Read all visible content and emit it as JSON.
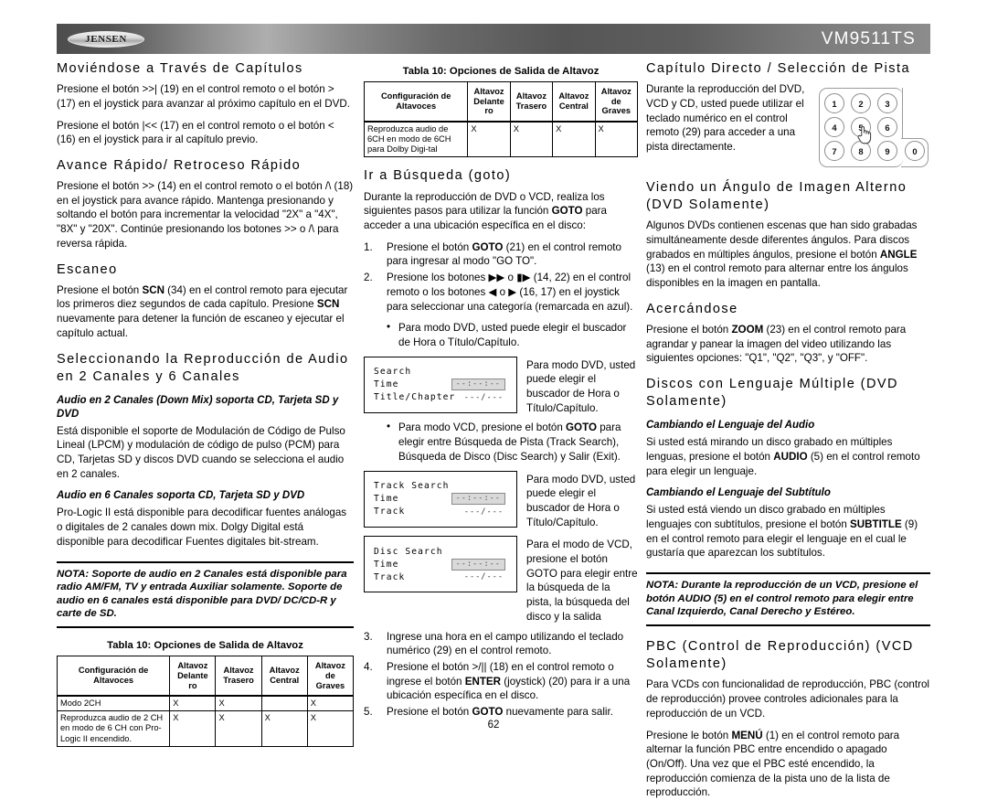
{
  "header": {
    "logo": "JENSEN",
    "model": "VM9511TS"
  },
  "page_number": "62",
  "left_column": {
    "sections": [
      {
        "heading": "Moviéndose a Través de Capítulos",
        "paragraphs": [
          "Presione el botón >>| (19) en el control remoto o el botón > (17) en el joystick para avanzar al próximo capítulo en el DVD.",
          "Presione el botón |<< (17) en el control remoto o el botón < (16) en el joystick para ir al capítulo previo."
        ]
      },
      {
        "heading": "Avance Rápido/ Retroceso Rápido",
        "paragraphs": [
          "Presione el botón >> (14) en el control remoto o el botón /\\ (18) en el joystick para avance rápido.  Mantenga presionando y soltando el botón para incrementar la velocidad \"2X\" a \"4X\", \"8X\" y \"20X\". Continúe presionando los botones >> o /\\ para reversa rápida."
        ]
      },
      {
        "heading": "Escaneo",
        "paragraphs": [
          "Presione el botón SCN (34) en el control remoto para ejecutar los primeros diez segundos de cada capítulo. Presione SCN nuevamente para detener la función de escaneo y ejecutar el capítulo actual."
        ]
      },
      {
        "heading": "Seleccionando la Reproducción de Audio en 2 Canales y 6 Canales",
        "subheading_1": "Audio en 2 Canales (Down Mix) soporta CD, Tarjeta SD y DVD",
        "paragraph_1": "Está disponible el soporte de Modulación de Código de Pulso Lineal (LPCM) y modulación de código de pulso (PCM) para CD, Tarjetas SD y discos DVD cuando se selecciona el audio en 2 canales.",
        "subheading_2": "Audio en 6 Canales soporta CD, Tarjeta SD y DVD",
        "paragraph_2": "Pro-Logic II está disponible para decodificar fuentes análogas o digitales de 2 canales down mix. Dolgy Digital está disponible para decodificar Fuentes digitales bit-stream."
      }
    ],
    "note": "NOTA: Soporte de audio en 2 Canales está disponible para radio AM/FM, TV y entrada Auxiliar solamente. Soporte de audio en 6 canales está disponible para DVD/ DC/CD-R y carte de SD.",
    "table": {
      "caption": "Tabla 10: Opciones de Salida de Altavoz",
      "headers": [
        "Configuración de Altavoces",
        "Altavoz Delante ro",
        "Altavoz Trasero",
        "Altavoz Central",
        "Altavoz de Graves"
      ],
      "rows": [
        {
          "label": "Modo 2CH",
          "marks": [
            "X",
            "X",
            "",
            "X"
          ]
        },
        {
          "label": "Reproduzca audio de 2 CH en modo de 6 CH con Pro-Logic II encendido.",
          "marks": [
            "X",
            "X",
            "X",
            "X"
          ]
        }
      ]
    }
  },
  "mid_column": {
    "table": {
      "caption": "Tabla 10: Opciones de Salida de Altavoz",
      "headers": [
        "Configuración de Altavoces",
        "Altavoz Delante ro",
        "Altavoz Trasero",
        "Altavoz Central",
        "Altavoz de Graves"
      ],
      "rows": [
        {
          "label": "Reproduzca audio de 6CH en modo de 6CH para Dolby Digi-tal",
          "marks": [
            "X",
            "X",
            "X",
            "X"
          ]
        }
      ]
    },
    "heading": "Ir a Búsqueda (goto)",
    "intro": "Durante la reproducción de DVD o VCD, realiza los siguientes pasos para utilizar la función GOTO para acceder a una ubicación específica en el disco:",
    "steps_1": [
      {
        "num": "1.",
        "text": "Presione el botón GOTO (21) en el control remoto para ingresar al modo \"GO TO\"."
      },
      {
        "num": "2.",
        "text": "Presione los botones ▶▶ o ▮▶ (14, 22) en el control remoto o los botones ◀ o ▶ (16, 17) en el joystick para seleccionar una categoría (remarcada en azul)."
      }
    ],
    "bullet_1": "Para modo DVD, usted puede elegir el buscador de Hora o Título/Capítulo.",
    "osd_1": {
      "title": "Search",
      "row_time_label": "Time",
      "row_time_value": "--:--:--",
      "row_chapter_label": "Title/Chapter",
      "row_chapter_value": "---/---",
      "caption": "Para modo DVD, usted puede elegir el buscador de Hora o Título/Capítulo."
    },
    "bullet_2": "Para modo VCD, presione el botón GOTO para elegir entre Búsqueda de Pista (Track Search), Búsqueda de Disco (Disc Search)  y Salir (Exit).",
    "osd_2": {
      "title": "Track Search",
      "row_time_label": "Time",
      "row_time_value": "--:--:--",
      "row_track_label": "Track",
      "row_track_value": "---/---",
      "caption": "Para modo DVD, usted puede elegir el buscador de Hora o Título/Capítulo."
    },
    "osd_3": {
      "title": "Disc Search",
      "row_time_label": "Time",
      "row_time_value": "--:--:--",
      "row_track_label": "Track",
      "row_track_value": "---/---",
      "caption": "Para el modo de VCD, presione el botón GOTO para elegir entre la búsqueda de la pista, la búsqueda del disco y la salida"
    },
    "steps_2": [
      {
        "num": "3.",
        "text": "Ingrese una hora en el campo utilizando el teclado numérico (29) en el control remoto."
      },
      {
        "num": "4.",
        "text": "Presione el botón >/|| (18) en el control remoto o ingrese el botón ENTER (joystick) (20) para ir a una ubicación específica en el disco."
      },
      {
        "num": "5.",
        "text": "Presione el botón GOTO nuevamente para salir."
      }
    ]
  },
  "right_column": {
    "sections": [
      {
        "heading": "Capítulo Directo /  Selección de Pista",
        "paragraph": "Durante la reproducción del DVD, VCD y CD, usted puede utilizar el teclado numérico en el control remoto (29) para acceder a una pista directamente."
      },
      {
        "heading": "Viendo un Ángulo de Imagen Alterno (DVD Solamente)",
        "paragraph": "Algunos DVDs contienen escenas que han sido grabadas simultáneamente desde diferentes ángulos. Para discos grabados en múltiples ángulos, presione el botón ANGLE (13) en el control remoto para alternar entre los ángulos disponibles en la imagen en pantalla."
      },
      {
        "heading": "Acercándose",
        "paragraph": "Presione el botón ZOOM (23) en el control remoto para agrandar y panear la imagen del video utilizando las siguientes opciones: \"Q1\", \"Q2\", \"Q3\", y \"OFF\"."
      },
      {
        "heading": "Discos con Lenguaje Múltiple (DVD Solamente)",
        "subheading_1": "Cambiando el Lenguaje del Audio",
        "paragraph_1": "Si usted está mirando un disco grabado en múltiples lenguas, presione el botón AUDIO (5)  en el control remoto para elegir un lenguaje.",
        "subheading_2": "Cambiando el Lenguaje del Subtítulo",
        "paragraph_2": "Si usted está viendo un disco grabado en múltiples lenguajes con subtítulos, presione el botón SUBTITLE (9) en el control remoto para elegir el lenguaje en el cual le gustaría que aparezcan los subtítulos."
      },
      {
        "heading": "PBC (Control de Reproducción) (VCD Solamente)",
        "paragraph_1": "Para VCDs con funcionalidad de reproducción, PBC (control de reproducción) provee controles adicionales para la reproducción de un VCD.",
        "paragraph_2": "Presione le botón MENÚ (1) en el control remoto para alternar la función PBC entre encendido o apagado (On/Off). Una vez que el PBC esté encendido, la reproducción comienza de la pista uno de la lista de reproducción."
      }
    ],
    "note": "NOTA: Durante la reproducción de un VCD, presione el botón AUDIO (5) en el control remoto para elegir entre Canal Izquierdo, Canal Derecho y Estéreo.",
    "keypad": {
      "keys": [
        "1",
        "2",
        "3",
        "4",
        "5",
        "6",
        "7",
        "8",
        "9",
        "0"
      ]
    }
  }
}
